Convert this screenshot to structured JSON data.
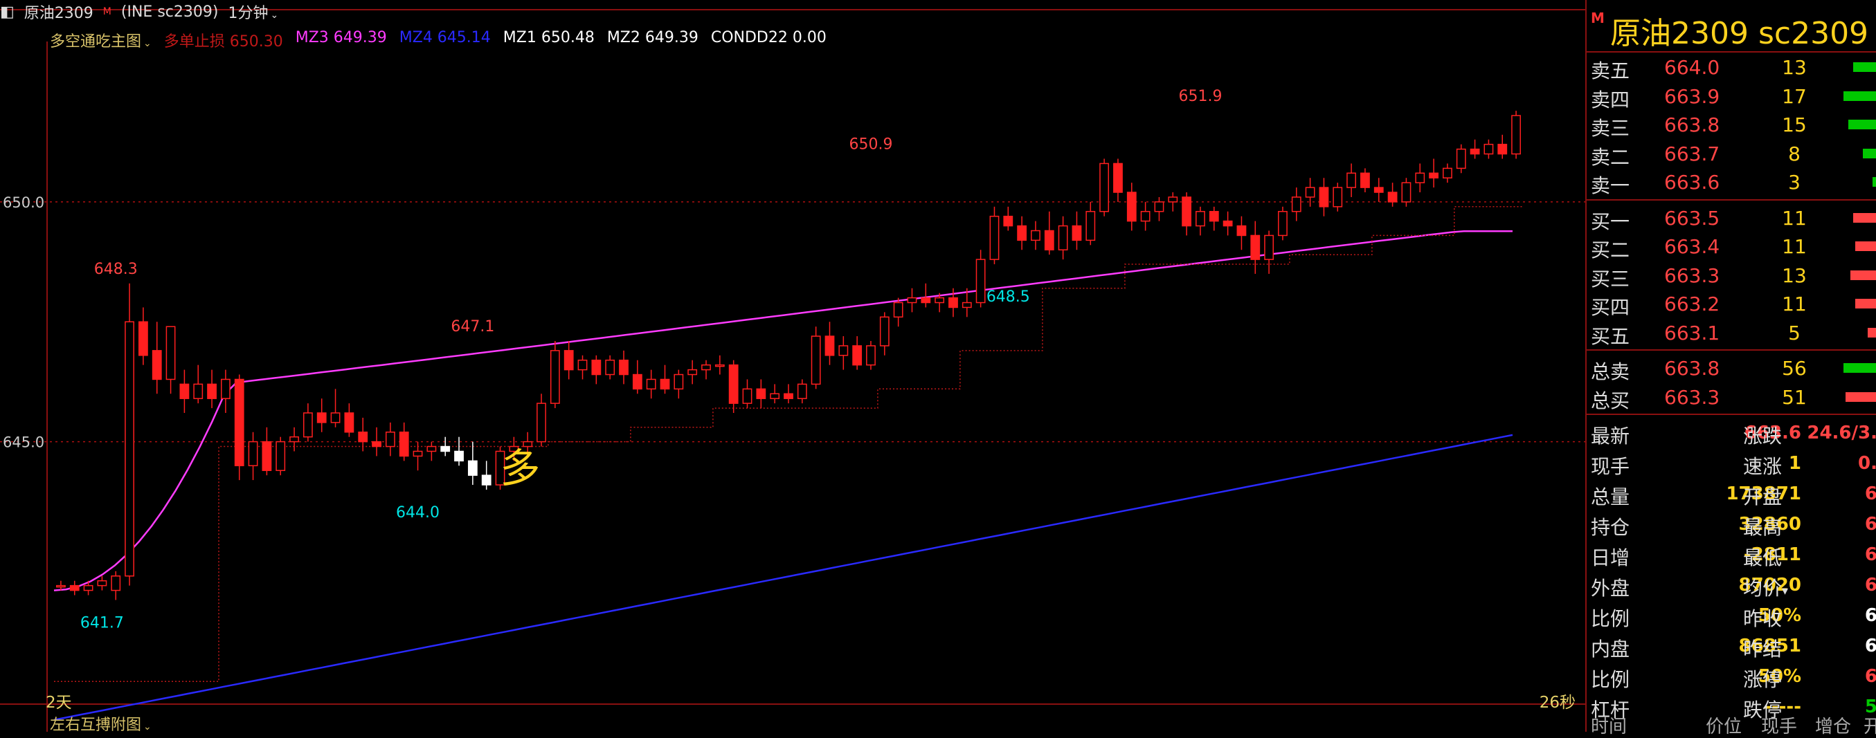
{
  "header": {
    "symbol": "原油2309",
    "exchange": "(INE sc2309)",
    "period": "1分钟"
  },
  "indicators": {
    "main_chart": "多空通吃主图",
    "items": [
      {
        "label": "多单止损 650.30",
        "color": "#c01818"
      },
      {
        "label": "MZ3 649.39",
        "color": "#ff3cff"
      },
      {
        "label": "MZ4 645.14",
        "color": "#2a2aff"
      },
      {
        "label": "MZ1 650.48",
        "color": "#ffffff"
      },
      {
        "label": "MZ2 649.39",
        "color": "#ffffff"
      },
      {
        "label": "CONDD22 0.00",
        "color": "#ffffff"
      }
    ]
  },
  "footer": {
    "sub_chart": "左右互搏附图",
    "period_days": "2天",
    "countdown": "26秒"
  },
  "chart_data": {
    "type": "candlestick",
    "y_ticks": [
      "650.0",
      "645.0"
    ],
    "ylim": [
      639.5,
      653.2
    ],
    "signal_text": "多",
    "annotations": [
      {
        "text": "648.3",
        "color": "#ff4444",
        "x": 4,
        "y": 648.3
      },
      {
        "text": "647.1",
        "color": "#ff4444",
        "x": 30,
        "y": 647.1
      },
      {
        "text": "650.9",
        "color": "#ff4444",
        "x": 59,
        "y": 650.9
      },
      {
        "text": "651.9",
        "color": "#ff4444",
        "x": 83,
        "y": 651.9
      },
      {
        "text": "644.0",
        "color": "#00e5e5",
        "x": 26,
        "y": 644.0
      },
      {
        "text": "648.5",
        "color": "#00e5e5",
        "x": 69,
        "y": 648.5
      },
      {
        "text": "641.7",
        "color": "#00e5e5",
        "x": 3,
        "y": 641.7
      }
    ],
    "candles": [
      [
        642.0,
        642.1,
        641.9,
        642.0
      ],
      [
        642.0,
        642.1,
        641.8,
        641.9
      ],
      [
        641.9,
        642.1,
        641.8,
        642.0
      ],
      [
        642.0,
        642.2,
        641.9,
        642.1
      ],
      [
        641.9,
        642.3,
        641.7,
        642.2
      ],
      [
        642.2,
        648.3,
        642.0,
        647.5
      ],
      [
        647.5,
        647.8,
        646.6,
        646.8
      ],
      [
        646.9,
        647.5,
        646.0,
        646.3
      ],
      [
        646.3,
        647.4,
        646.0,
        647.4
      ],
      [
        646.2,
        646.5,
        645.6,
        645.9
      ],
      [
        645.9,
        646.6,
        645.8,
        646.2
      ],
      [
        646.2,
        646.5,
        645.7,
        645.9
      ],
      [
        645.9,
        646.5,
        645.6,
        646.3
      ],
      [
        646.3,
        646.4,
        644.2,
        644.5
      ],
      [
        644.5,
        645.2,
        644.2,
        645.0
      ],
      [
        645.0,
        645.3,
        644.3,
        644.4
      ],
      [
        644.4,
        645.1,
        644.3,
        645.0
      ],
      [
        645.0,
        645.3,
        644.8,
        645.1
      ],
      [
        645.1,
        645.8,
        645.0,
        645.6
      ],
      [
        645.6,
        645.9,
        645.2,
        645.4
      ],
      [
        645.4,
        646.1,
        645.3,
        645.6
      ],
      [
        645.6,
        645.8,
        645.1,
        645.2
      ],
      [
        645.2,
        645.5,
        644.8,
        645.0
      ],
      [
        645.0,
        645.3,
        644.7,
        644.9
      ],
      [
        644.9,
        645.4,
        644.7,
        645.2
      ],
      [
        645.2,
        645.4,
        644.6,
        644.7
      ],
      [
        644.7,
        645.0,
        644.4,
        644.8
      ],
      [
        644.8,
        645.0,
        644.6,
        644.9
      ],
      [
        644.9,
        645.1,
        644.7,
        644.8
      ],
      [
        644.8,
        645.1,
        644.5,
        644.6
      ],
      [
        644.6,
        645.0,
        644.1,
        644.3
      ],
      [
        644.3,
        644.6,
        644.0,
        644.1
      ],
      [
        644.1,
        644.9,
        644.0,
        644.8
      ],
      [
        644.8,
        645.1,
        644.6,
        644.9
      ],
      [
        644.9,
        645.2,
        644.7,
        645.0
      ],
      [
        645.0,
        646.0,
        644.9,
        645.8
      ],
      [
        645.8,
        647.1,
        645.7,
        646.9
      ],
      [
        646.9,
        647.1,
        646.3,
        646.5
      ],
      [
        646.5,
        646.8,
        646.3,
        646.7
      ],
      [
        646.7,
        646.8,
        646.2,
        646.4
      ],
      [
        646.4,
        646.8,
        646.3,
        646.7
      ],
      [
        646.7,
        646.9,
        646.2,
        646.4
      ],
      [
        646.4,
        646.7,
        646.0,
        646.1
      ],
      [
        646.1,
        646.5,
        645.9,
        646.3
      ],
      [
        646.3,
        646.6,
        646.0,
        646.1
      ],
      [
        646.1,
        646.5,
        645.9,
        646.4
      ],
      [
        646.4,
        646.7,
        646.2,
        646.5
      ],
      [
        646.5,
        646.7,
        646.3,
        646.6
      ],
      [
        646.6,
        646.8,
        646.4,
        646.6
      ],
      [
        646.6,
        646.7,
        645.6,
        645.8
      ],
      [
        645.8,
        646.3,
        645.7,
        646.1
      ],
      [
        646.1,
        646.3,
        645.7,
        645.9
      ],
      [
        645.9,
        646.2,
        645.8,
        646.0
      ],
      [
        646.0,
        646.2,
        645.8,
        645.9
      ],
      [
        645.9,
        646.3,
        645.8,
        646.2
      ],
      [
        646.2,
        647.4,
        646.1,
        647.2
      ],
      [
        647.2,
        647.5,
        646.6,
        646.8
      ],
      [
        646.8,
        647.2,
        646.5,
        647.0
      ],
      [
        647.0,
        647.2,
        646.5,
        646.6
      ],
      [
        646.6,
        647.1,
        646.5,
        647.0
      ],
      [
        647.0,
        647.7,
        646.8,
        647.6
      ],
      [
        647.6,
        648.0,
        647.4,
        647.9
      ],
      [
        647.9,
        648.2,
        647.7,
        648.0
      ],
      [
        648.0,
        648.3,
        647.8,
        647.9
      ],
      [
        647.9,
        648.1,
        647.7,
        648.0
      ],
      [
        648.0,
        648.2,
        647.6,
        647.8
      ],
      [
        647.8,
        648.2,
        647.6,
        647.9
      ],
      [
        647.9,
        649.0,
        647.8,
        648.8
      ],
      [
        648.8,
        649.9,
        648.7,
        649.7
      ],
      [
        649.7,
        649.9,
        649.4,
        649.5
      ],
      [
        649.5,
        649.7,
        649.0,
        649.2
      ],
      [
        649.2,
        649.6,
        649.0,
        649.4
      ],
      [
        649.4,
        649.8,
        648.9,
        649.0
      ],
      [
        649.0,
        649.7,
        648.8,
        649.5
      ],
      [
        649.5,
        649.8,
        649.0,
        649.2
      ],
      [
        649.2,
        650.0,
        649.1,
        649.8
      ],
      [
        649.8,
        650.9,
        649.7,
        650.8
      ],
      [
        650.8,
        650.9,
        650.0,
        650.2
      ],
      [
        650.2,
        650.4,
        649.4,
        649.6
      ],
      [
        649.6,
        650.0,
        649.4,
        649.8
      ],
      [
        649.8,
        650.1,
        649.6,
        650.0
      ],
      [
        650.0,
        650.2,
        649.8,
        650.1
      ],
      [
        650.1,
        650.2,
        649.3,
        649.5
      ],
      [
        649.5,
        649.9,
        649.3,
        649.8
      ],
      [
        649.8,
        649.9,
        649.4,
        649.6
      ],
      [
        649.6,
        649.8,
        649.3,
        649.5
      ],
      [
        649.5,
        649.7,
        649.0,
        649.3
      ],
      [
        649.3,
        649.6,
        648.5,
        648.8
      ],
      [
        648.8,
        649.4,
        648.5,
        649.3
      ],
      [
        649.3,
        649.9,
        649.2,
        649.8
      ],
      [
        649.8,
        650.3,
        649.6,
        650.1
      ],
      [
        650.1,
        650.5,
        649.9,
        650.3
      ],
      [
        650.3,
        650.5,
        649.7,
        649.9
      ],
      [
        649.9,
        650.4,
        649.8,
        650.3
      ],
      [
        650.3,
        650.8,
        650.1,
        650.6
      ],
      [
        650.6,
        650.7,
        650.2,
        650.3
      ],
      [
        650.3,
        650.5,
        650.0,
        650.2
      ],
      [
        650.2,
        650.4,
        649.9,
        650.0
      ],
      [
        650.0,
        650.5,
        649.9,
        650.4
      ],
      [
        650.4,
        650.8,
        650.2,
        650.6
      ],
      [
        650.6,
        650.9,
        650.3,
        650.5
      ],
      [
        650.5,
        650.8,
        650.4,
        650.7
      ],
      [
        650.7,
        651.2,
        650.6,
        651.1
      ],
      [
        651.1,
        651.3,
        650.9,
        651.0
      ],
      [
        651.0,
        651.3,
        650.9,
        651.2
      ],
      [
        651.2,
        651.4,
        650.9,
        651.0
      ],
      [
        651.0,
        651.9,
        650.9,
        651.8
      ]
    ],
    "series": [
      {
        "name": "MZ3",
        "color": "#ff3cff",
        "start": 641.9,
        "end": 649.39
      },
      {
        "name": "MZ4",
        "color": "#2a2aff",
        "start": 639.2,
        "end": 645.14
      }
    ]
  },
  "order_book": {
    "title": "原油2309  sc2309",
    "asks": [
      {
        "label": "卖五",
        "price": "664.0",
        "vol": "13",
        "bar": 0.5,
        "color": "#00c800"
      },
      {
        "label": "卖四",
        "price": "663.9",
        "vol": "17",
        "bar": 0.7,
        "color": "#00c800"
      },
      {
        "label": "卖三",
        "price": "663.8",
        "vol": "15",
        "bar": 0.6,
        "color": "#00c800"
      },
      {
        "label": "卖二",
        "price": "663.7",
        "vol": "8",
        "bar": 0.3,
        "color": "#00c800"
      },
      {
        "label": "卖一",
        "price": "663.6",
        "vol": "3",
        "bar": 0.1,
        "color": "#00c800"
      }
    ],
    "bids": [
      {
        "label": "买一",
        "price": "663.5",
        "vol": "11",
        "bar": 0.5,
        "color": "#ff4444"
      },
      {
        "label": "买二",
        "price": "663.4",
        "vol": "11",
        "bar": 0.45,
        "color": "#ff4444"
      },
      {
        "label": "买三",
        "price": "663.3",
        "vol": "13",
        "bar": 0.55,
        "color": "#ff4444"
      },
      {
        "label": "买四",
        "price": "663.2",
        "vol": "11",
        "bar": 0.45,
        "color": "#ff4444"
      },
      {
        "label": "买五",
        "price": "663.1",
        "vol": "5",
        "bar": 0.2,
        "color": "#ff4444"
      }
    ],
    "totals": [
      {
        "label": "总卖",
        "price": "663.8",
        "vol": "56",
        "bar": 0.7,
        "color": "#00c800"
      },
      {
        "label": "总买",
        "price": "663.3",
        "vol": "51",
        "bar": 0.65,
        "color": "#ff4444"
      }
    ]
  },
  "stats": [
    {
      "l1": "最新",
      "v1": "663.6",
      "v1c": "#ff4444",
      "l2": "涨跌",
      "v2": "24.6/3.",
      "v2c": "#ff4444"
    },
    {
      "l1": "现手",
      "v1": "1",
      "v1c": "#ffd21e",
      "l2": "速涨",
      "v2": "0.",
      "v2c": "#ff4444"
    },
    {
      "l1": "总量",
      "v1": "173871",
      "v1c": "#ffd21e",
      "l2": "开盘",
      "v2": "6",
      "v2c": "#ff4444"
    },
    {
      "l1": "持仓",
      "v1": "32860",
      "v1c": "#ffd21e",
      "l2": "最高",
      "v2": "6",
      "v2c": "#ff4444"
    },
    {
      "l1": "日增",
      "v1": "-2811",
      "v1c": "#ffd21e",
      "l2": "最低",
      "v2": "6",
      "v2c": "#ff4444"
    },
    {
      "l1": "外盘",
      "v1": "87020",
      "v1c": "#ffd21e",
      "l2": "均价",
      "v2": "6",
      "v2c": "#ff4444"
    },
    {
      "l1": "比例",
      "v1": "50%",
      "v1c": "#ffd21e",
      "l2": "昨收",
      "v2": "6",
      "v2c": "#ffffff"
    },
    {
      "l1": "内盘",
      "v1": "86851",
      "v1c": "#ffd21e",
      "l2": "昨结",
      "v2": "6",
      "v2c": "#ffffff"
    },
    {
      "l1": "比例",
      "v1": "50%",
      "v1c": "#ffd21e",
      "l2": "涨停",
      "v2": "6",
      "v2c": "#ff4444"
    },
    {
      "l1": "杠杆",
      "v1": "-----",
      "v1c": "#ffd21e",
      "l2": "跌停",
      "v2": "5",
      "v2c": "#00c800"
    }
  ],
  "trade_header": [
    "时间",
    "价位",
    "现手",
    "增仓",
    "开"
  ]
}
